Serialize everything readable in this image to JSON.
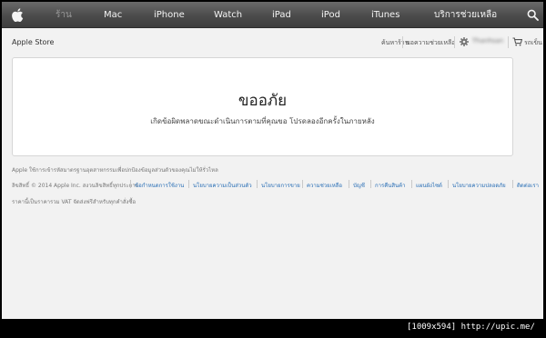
{
  "nav": {
    "items": [
      {
        "label": "ร้าน"
      },
      {
        "label": "Mac"
      },
      {
        "label": "iPhone"
      },
      {
        "label": "Watch"
      },
      {
        "label": "iPad"
      },
      {
        "label": "iPod"
      },
      {
        "label": "iTunes"
      },
      {
        "label": "บริการช่วยเหลือ"
      }
    ],
    "search_icon": "search-icon",
    "logo_icon": "apple-logo-icon"
  },
  "subnav": {
    "title": "Apple Store",
    "links": [
      {
        "label": "ค้นหาร้าน"
      },
      {
        "label": "ขอความช่วยเหลือ"
      }
    ],
    "account_icon": "gear-icon",
    "account_name": "Thanhsan",
    "cart_icon": "cart-icon",
    "cart_label": "รถเข็น"
  },
  "error": {
    "title": "ขออภัย",
    "message": "เกิดข้อผิดพลาดขณะดำเนินการตามที่คุณขอ โปรดลองอีกครั้งในภายหลัง"
  },
  "footer": {
    "notice": "Apple ใช้การเข้ารหัสมาตรฐานอุตสาหกรรมเพื่อปกป้องข้อมูลส่วนตัวของคุณไม่ให้รั่วไหล",
    "copyright": "ลิขสิทธิ์ © 2014 Apple Inc. สงวนลิขสิทธิ์ทุกประการ",
    "links": [
      {
        "label": "ข้อกำหนดการใช้งาน"
      },
      {
        "label": "นโยบายความเป็นส่วนตัว"
      },
      {
        "label": "นโยบายการขาย"
      },
      {
        "label": "ความช่วยเหลือ"
      },
      {
        "label": "บัญชี"
      },
      {
        "label": "การคืนสินค้า"
      },
      {
        "label": "แผนผังไซต์"
      },
      {
        "label": "นโยบายความปลอดภัย"
      },
      {
        "label": "ติดต่อเรา"
      }
    ],
    "vat_note": "ราคานี้เป็นราคารวม VAT จัดส่งฟรีสำหรับทุกคำสั่งซื้อ"
  },
  "watermark": "[1009x594] http://upic.me/",
  "colors": {
    "nav_background": "#4b4b4b",
    "link": "#2a6fb6",
    "page_background": "#f2f2f2"
  }
}
